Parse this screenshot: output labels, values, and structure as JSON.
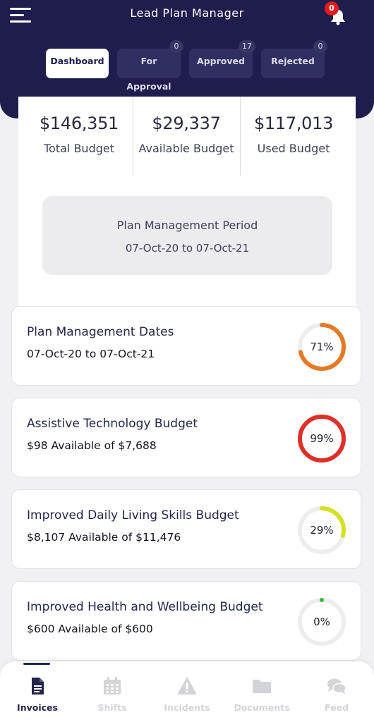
{
  "header": {
    "title": "Lead Plan Manager",
    "notification_count": "0"
  },
  "tabs": [
    {
      "label": "Dashboard",
      "count": "",
      "active": true
    },
    {
      "label": "For Approval",
      "count": "0",
      "active": false
    },
    {
      "label": "Approved",
      "count": "17",
      "active": false
    },
    {
      "label": "Rejected",
      "count": "0",
      "active": false
    }
  ],
  "summary": {
    "total": {
      "amount": "$146,351",
      "label": "Total Budget"
    },
    "available": {
      "amount": "$29,337",
      "label": "Available Budget"
    },
    "used": {
      "amount": "$117,013",
      "label": "Used Budget"
    }
  },
  "period": {
    "title": "Plan Management Period",
    "dates": "07-Oct-20 to 07-Oct-21"
  },
  "cards": [
    {
      "title": "Plan Management Dates",
      "subtitle": "07-Oct-20 to 07-Oct-21",
      "percent_label": "71%",
      "percent": 71,
      "color": "#e57a25"
    },
    {
      "title": "Assistive Technology Budget",
      "subtitle": "$98 Available of $7,688",
      "percent_label": "99%",
      "percent": 99,
      "color": "#e02f26"
    },
    {
      "title": "Improved Daily Living Skills Budget",
      "subtitle": "$8,107 Available of $11,476",
      "percent_label": "29%",
      "percent": 29,
      "color": "#d7e020"
    },
    {
      "title": "Improved Health and Wellbeing Budget",
      "subtitle": "$600 Available of $600",
      "percent_label": "0%",
      "percent": 0,
      "color": "#2fbd38"
    }
  ],
  "ring_track_color": "#ededed",
  "bottom_nav": [
    {
      "label": "Invoices",
      "icon": "invoice-icon",
      "active": true
    },
    {
      "label": "Shifts",
      "icon": "calendar-icon",
      "active": false
    },
    {
      "label": "Incidents",
      "icon": "warning-icon",
      "active": false
    },
    {
      "label": "Documents",
      "icon": "folder-icon",
      "active": false
    },
    {
      "label": "Feed",
      "icon": "chat-icon",
      "active": false
    }
  ],
  "colors": {
    "header_bg": "#1e1d4d",
    "active_nav": "#23264a",
    "inactive_nav": "#d3d3da"
  }
}
